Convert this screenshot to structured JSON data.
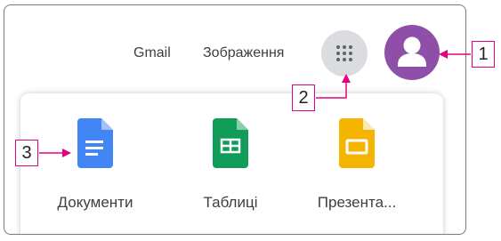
{
  "header": {
    "links": {
      "gmail": "Gmail",
      "images": "Зображення"
    },
    "apps_button_icon": "apps-grid-icon",
    "avatar_icon": "account-icon",
    "avatar_color": "#8e4fa8"
  },
  "apps_panel": {
    "apps": [
      {
        "label": "Документи",
        "icon": "docs-icon",
        "color": "#4285f4"
      },
      {
        "label": "Таблиці",
        "icon": "sheets-icon",
        "color": "#0f9d58"
      },
      {
        "label": "Презента...",
        "icon": "slides-icon",
        "color": "#f4b400"
      }
    ]
  },
  "callouts": {
    "account": "1",
    "apps_button": "2",
    "docs": "3",
    "color": "#e6007e"
  }
}
